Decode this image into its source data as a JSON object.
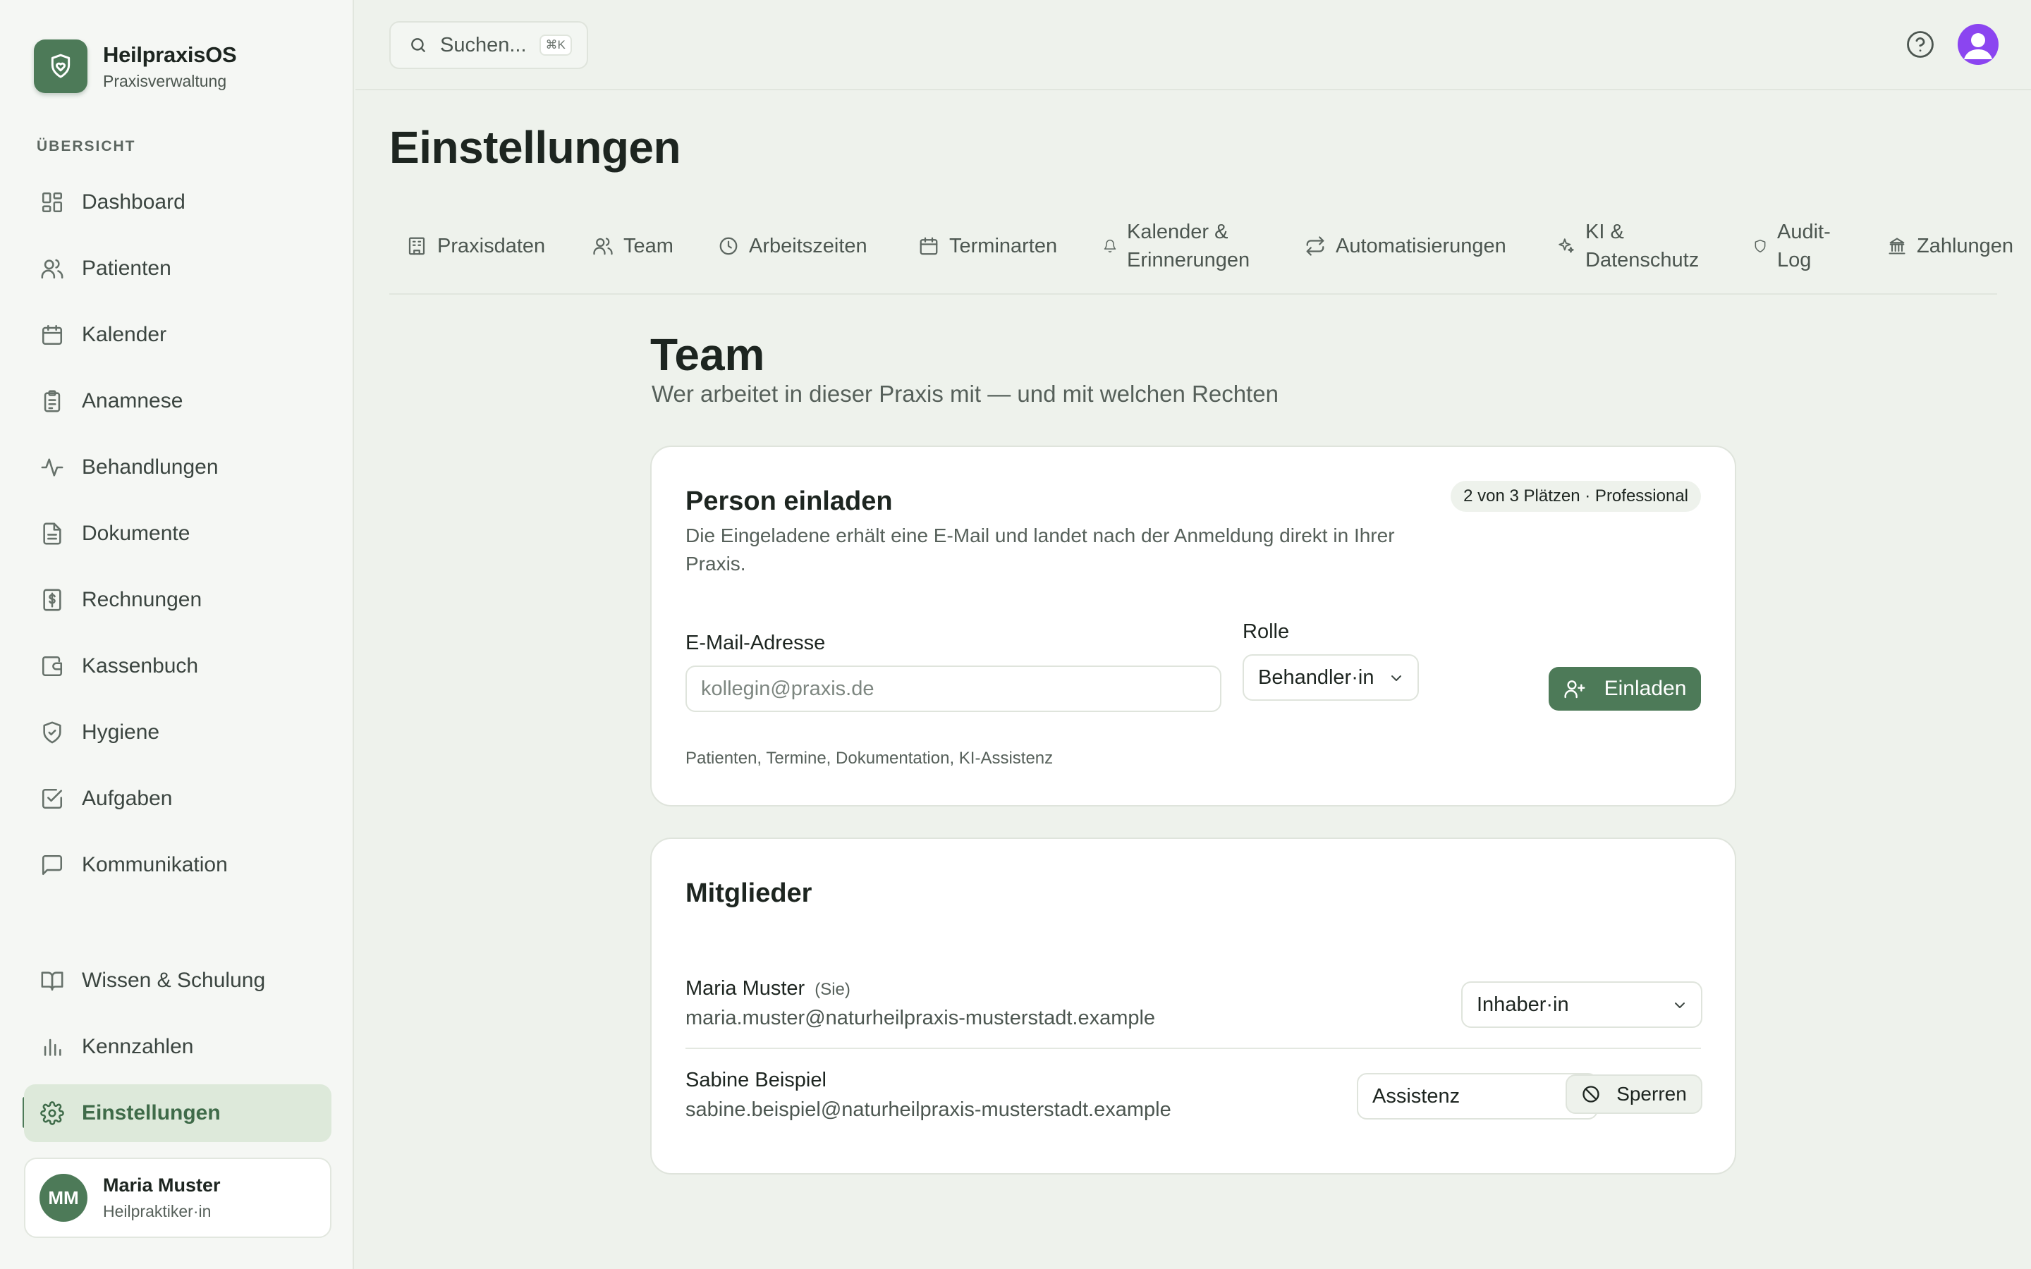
{
  "brand": {
    "name": "HeilpraxisOS",
    "subtitle": "Praxisverwaltung"
  },
  "sidebar": {
    "section_label": "ÜBERSICHT",
    "items": [
      {
        "label": "Dashboard",
        "icon": "dashboard-icon"
      },
      {
        "label": "Patienten",
        "icon": "users-icon"
      },
      {
        "label": "Kalender",
        "icon": "calendar-icon"
      },
      {
        "label": "Anamnese",
        "icon": "clipboard-icon"
      },
      {
        "label": "Behandlungen",
        "icon": "activity-icon"
      },
      {
        "label": "Dokumente",
        "icon": "document-icon"
      },
      {
        "label": "Rechnungen",
        "icon": "invoice-icon"
      },
      {
        "label": "Kassenbuch",
        "icon": "wallet-icon"
      },
      {
        "label": "Hygiene",
        "icon": "shield-check-icon"
      },
      {
        "label": "Aufgaben",
        "icon": "checkbox-icon"
      },
      {
        "label": "Kommunikation",
        "icon": "message-icon"
      }
    ],
    "bottom_items": [
      {
        "label": "Wissen & Schulung",
        "icon": "book-icon"
      },
      {
        "label": "Kennzahlen",
        "icon": "bar-chart-icon"
      },
      {
        "label": "Einstellungen",
        "icon": "gear-icon",
        "active": true
      }
    ],
    "user": {
      "initials": "MM",
      "name": "Maria Muster",
      "role": "Heilpraktiker·in"
    }
  },
  "topbar": {
    "search_placeholder": "Suchen...",
    "shortcut": "⌘K"
  },
  "page": {
    "title": "Einstellungen"
  },
  "tabs": [
    {
      "label": "Praxisdaten",
      "icon": "building-icon"
    },
    {
      "label": "Team",
      "icon": "users-icon"
    },
    {
      "label": "Arbeitszeiten",
      "icon": "clock-icon"
    },
    {
      "label": "Terminarten",
      "icon": "calendar-icon"
    },
    {
      "label_line1": "Kalender &",
      "label_line2": "Erinnerungen",
      "icon": "bell-icon"
    },
    {
      "label": "Automatisierungen",
      "icon": "repeat-icon"
    },
    {
      "label_line1": "KI &",
      "label_line2": "Datenschutz",
      "icon": "sparkles-icon"
    },
    {
      "label_line1": "Audit-",
      "label_line2": "Log",
      "icon": "shield-icon"
    },
    {
      "label": "Zahlungen",
      "icon": "bank-icon"
    }
  ],
  "team": {
    "title": "Team",
    "subtitle": "Wer arbeitet in dieser Praxis mit — und mit welchen Rechten",
    "invite": {
      "title": "Person einladen",
      "badge": "2 von 3 Plätzen · Professional",
      "description": "Die Eingeladene erhält eine E-Mail und landet nach der Anmeldung direkt in Ihrer Praxis.",
      "email_label": "E-Mail-Adresse",
      "email_placeholder": "kollegin@praxis.de",
      "role_label": "Rolle",
      "role_value": "Behandler·in",
      "button": "Einladen",
      "permissions_hint": "Patienten, Termine, Dokumentation, KI-Assistenz"
    },
    "members": {
      "title": "Mitglieder",
      "list": [
        {
          "name": "Maria Muster",
          "you_tag": "(Sie)",
          "email": "maria.muster@naturheilpraxis-musterstadt.example",
          "role": "Inhaber·in"
        },
        {
          "name": "Sabine Beispiel",
          "email": "sabine.beispiel@naturheilpraxis-musterstadt.example",
          "role": "Assistenz",
          "action": "Sperren"
        }
      ]
    }
  },
  "colors": {
    "accent": "#4d7a58",
    "background": "#eef2ec",
    "sidebar": "#f5f7f4",
    "profile": "#8b45f0"
  }
}
